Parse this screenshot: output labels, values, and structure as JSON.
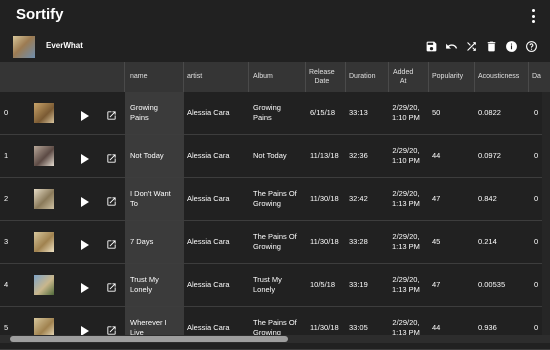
{
  "app": {
    "title": "Sortify"
  },
  "playlist": {
    "name": "EverWhat"
  },
  "toolbar": {
    "icons": [
      "save-icon",
      "undo-icon",
      "shuffle-icon",
      "delete-icon",
      "info-icon",
      "help-icon"
    ]
  },
  "table": {
    "columns": [
      "name",
      "artist",
      "Album",
      "Release\nDate",
      "Duration",
      "Added\nAt",
      "Popularity",
      "Acousticness",
      "Da"
    ],
    "rows": [
      {
        "index": "0",
        "name": "Growing\nPains",
        "artist": "Alessia Cara",
        "album": "Growing\nPains",
        "release_date": "6/15/18",
        "duration": "33:13",
        "added_at": "2/29/20,\n1:10 PM",
        "popularity": "50",
        "acousticness": "0.0822",
        "da": "0"
      },
      {
        "index": "1",
        "name": "Not Today",
        "artist": "Alessia Cara",
        "album": "Not Today",
        "release_date": "11/13/18",
        "duration": "32:36",
        "added_at": "2/29/20,\n1:10 PM",
        "popularity": "44",
        "acousticness": "0.0972",
        "da": "0"
      },
      {
        "index": "2",
        "name": "I Don't Want\nTo",
        "artist": "Alessia Cara",
        "album": "The Pains Of\nGrowing",
        "release_date": "11/30/18",
        "duration": "32:42",
        "added_at": "2/29/20,\n1:13 PM",
        "popularity": "47",
        "acousticness": "0.842",
        "da": "0"
      },
      {
        "index": "3",
        "name": "7 Days",
        "artist": "Alessia Cara",
        "album": "The Pains Of\nGrowing",
        "release_date": "11/30/18",
        "duration": "33:28",
        "added_at": "2/29/20,\n1:13 PM",
        "popularity": "45",
        "acousticness": "0.214",
        "da": "0"
      },
      {
        "index": "4",
        "name": "Trust My\nLonely",
        "artist": "Alessia Cara",
        "album": "Trust My\nLonely",
        "release_date": "10/5/18",
        "duration": "33:19",
        "added_at": "2/29/20,\n1:13 PM",
        "popularity": "47",
        "acousticness": "0.00535",
        "da": "0"
      },
      {
        "index": "5",
        "name": "Wherever I\nLive",
        "artist": "Alessia Cara",
        "album": "The Pains Of\nGrowing",
        "release_date": "11/30/18",
        "duration": "33:05",
        "added_at": "2/29/20,\n1:13 PM",
        "popularity": "44",
        "acousticness": "0.936",
        "da": "0"
      }
    ]
  },
  "colors": {
    "background": "#212121",
    "header": "#353535",
    "name_column": "#3b3b3b"
  }
}
